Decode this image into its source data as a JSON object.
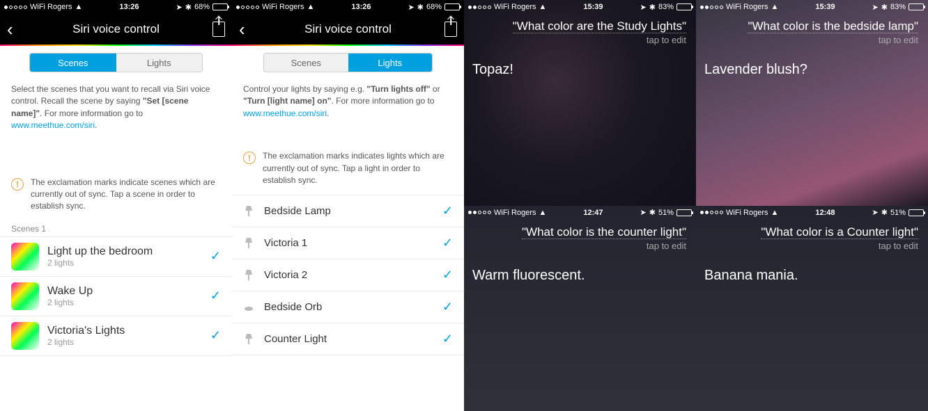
{
  "status_common": {
    "carrier": "WiFi Rogers",
    "loc_arrow": "➤",
    "bt": "✱"
  },
  "panel_a": {
    "time": "13:26",
    "battery": "68%",
    "title": "Siri voice control",
    "tabs": {
      "scenes": "Scenes",
      "lights": "Lights"
    },
    "intro_p1": "Select the scenes that you want to recall via Siri voice control. Recall the scene by saying ",
    "intro_bold": "\"Set [scene name]\"",
    "intro_p2": ". For more information go to ",
    "intro_link": "www.meethue.com/siri",
    "intro_tail": ".",
    "warn": "The exclamation marks indicate scenes which are currently out of sync. Tap a scene in order to establish sync.",
    "section": "Scenes 1",
    "scenes": [
      {
        "name": "Light up the bedroom",
        "sub": "2 lights"
      },
      {
        "name": "Wake Up",
        "sub": "2 lights"
      },
      {
        "name": "Victoria's Lights",
        "sub": "2 lights"
      }
    ]
  },
  "panel_b": {
    "time": "13:26",
    "battery": "68%",
    "title": "Siri voice control",
    "tabs": {
      "scenes": "Scenes",
      "lights": "Lights"
    },
    "intro_p1": "Control your lights by saying e.g. ",
    "intro_bold1": "\"Turn lights off\"",
    "intro_or": " or ",
    "intro_bold2": "\"Turn [light name] on\"",
    "intro_p2": ". For more information go to ",
    "intro_link": "www.meethue.com/siri",
    "intro_tail": ".",
    "warn": "The exclamation marks indicates lights which are currently out of sync. Tap a light in order to establish sync.",
    "lights": [
      {
        "name": "Bedside Lamp",
        "icon": "lamp"
      },
      {
        "name": "Victoria 1",
        "icon": "lamp"
      },
      {
        "name": "Victoria 2",
        "icon": "lamp"
      },
      {
        "name": "Bedside Orb",
        "icon": "orb"
      },
      {
        "name": "Counter Light",
        "icon": "lamp"
      }
    ]
  },
  "siri": {
    "edit": "tap to edit",
    "cells": [
      {
        "time": "15:39",
        "battery": "83%",
        "q": "\"What color are the Study Lights\"",
        "a": "Topaz!",
        "bg": "norm"
      },
      {
        "time": "15:39",
        "battery": "83%",
        "q": "\"What color is the bedside lamp\"",
        "a": "Lavender blush?",
        "bg": "alt"
      },
      {
        "time": "12:47",
        "battery": "51%",
        "q": "\"What color is the counter light\"",
        "a": "Warm fluorescent.",
        "bg": "dark"
      },
      {
        "time": "12:48",
        "battery": "51%",
        "q": "\"What color is a Counter light\"",
        "a": "Banana mania.",
        "bg": "dark"
      }
    ]
  }
}
